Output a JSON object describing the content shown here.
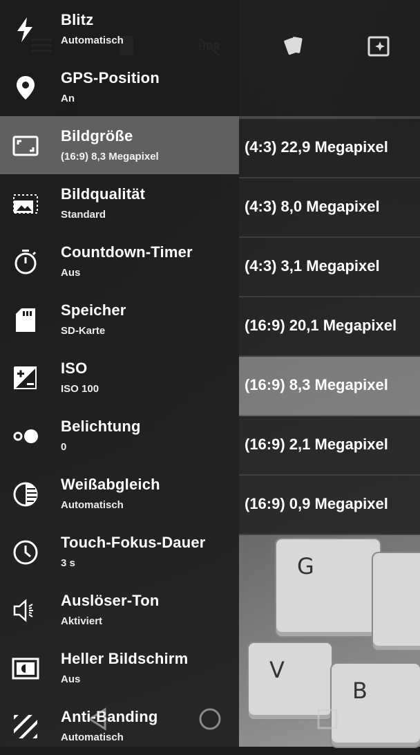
{
  "settings": {
    "items": [
      {
        "title": "Blitz",
        "sub": "Automatisch",
        "icon": "flash-icon"
      },
      {
        "title": "GPS-Position",
        "sub": "An",
        "icon": "location-pin-icon"
      },
      {
        "title": "Bildgröße",
        "sub": "(16:9) 8,3 Megapixel",
        "icon": "image-size-icon"
      },
      {
        "title": "Bildqualität",
        "sub": "Standard",
        "icon": "image-quality-icon"
      },
      {
        "title": "Countdown-Timer",
        "sub": "Aus",
        "icon": "timer-icon"
      },
      {
        "title": "Speicher",
        "sub": "SD-Karte",
        "icon": "sd-card-icon"
      },
      {
        "title": "ISO",
        "sub": "ISO 100",
        "icon": "iso-icon"
      },
      {
        "title": "Belichtung",
        "sub": "0",
        "icon": "exposure-icon"
      },
      {
        "title": "Weißabgleich",
        "sub": "Automatisch",
        "icon": "white-balance-icon"
      },
      {
        "title": "Touch-Fokus-Dauer",
        "sub": "3 s",
        "icon": "clock-icon"
      },
      {
        "title": "Auslöser-Ton",
        "sub": "Aktiviert",
        "icon": "speaker-icon"
      },
      {
        "title": "Heller Bildschirm",
        "sub": "Aus",
        "icon": "bright-screen-icon"
      },
      {
        "title": "Anti-Banding",
        "sub": "Automatisch",
        "icon": "anti-banding-icon"
      }
    ],
    "selected_index": 2
  },
  "picture_size_options": {
    "items": [
      "(4:3) 22,9 Megapixel",
      "(4:3) 8,0 Megapixel",
      "(4:3) 3,1 Megapixel",
      "(16:9) 20,1 Megapixel",
      "(16:9) 8,3 Megapixel",
      "(16:9) 2,1 Megapixel",
      "(16:9) 0,9 Megapixel"
    ],
    "selected_index": 4
  },
  "camera_top_bar": {
    "icons": [
      "menu-icon",
      "switch-camera-icon",
      "hdr-off-icon",
      "filters-icon",
      "scene-icon"
    ]
  },
  "nav_bar": {
    "icons": [
      "back-icon",
      "home-icon",
      "recents-icon"
    ]
  },
  "colors": {
    "drawer_bg": "#1c1c1c",
    "selected_bg": "#8f8f8f",
    "text": "#ffffff"
  }
}
